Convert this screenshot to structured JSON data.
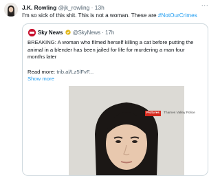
{
  "post": {
    "author_name": "J.K. Rowling",
    "handle": "@jk_rowling",
    "separator": "·",
    "time": "13h",
    "more_label": "···",
    "text_before": "I'm so sick of this shit. This is not a woman. These are ",
    "hashtag": "#NotOurCrimes"
  },
  "quoted_post": {
    "author_name": "Sky News",
    "handle": "@SkyNews",
    "separator": "·",
    "time": "17h",
    "body_lines": [
      "BREAKING: A woman who filmed herself killing a cat before putting the",
      "animal in a blender has been jailed for life for murdering a man four",
      "months later"
    ],
    "read_more_prefix": "Read more: ",
    "read_more_link": "trib.al/Lz5lFvF...",
    "show_more": "Show more",
    "image_tag": "Pictures",
    "image_credit": "Thames Valley Police"
  },
  "colors": {
    "link_blue": "#1d9bf0",
    "muted": "#536471",
    "border": "#cfd9de",
    "sky_news_red": "#c8102e",
    "verified_gold": "#e2b719"
  },
  "icons": {
    "verified": "verified-badge-icon",
    "more": "more-options-icon"
  }
}
